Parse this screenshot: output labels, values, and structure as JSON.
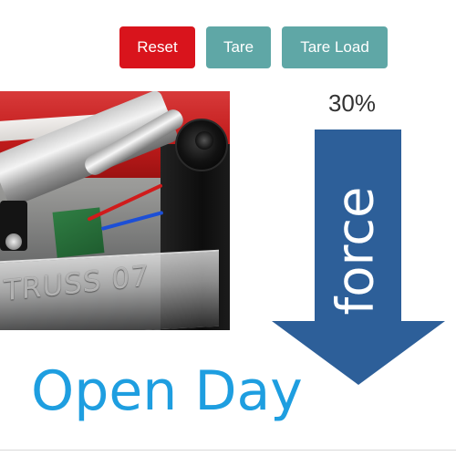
{
  "toolbar": {
    "reset_label": "Reset",
    "tare_label": "Tare",
    "tare_load_label": "Tare Load"
  },
  "photo": {
    "engraved_text": "TRUSS 07"
  },
  "force": {
    "percent": "30%",
    "label": "force",
    "arrow_color": "#2d5f99"
  },
  "title": "Open Day",
  "colors": {
    "reset": "#d9141c",
    "tare": "#5fa7a6",
    "title": "#1e9ee0",
    "percent_text": "#333333"
  }
}
